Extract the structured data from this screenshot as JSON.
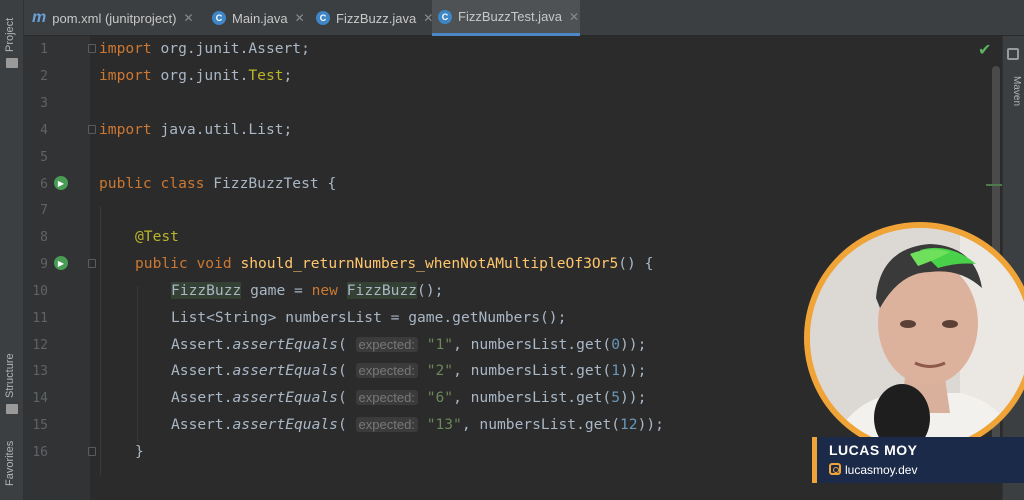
{
  "left_strip": {
    "project_label": "Project",
    "structure_label": "Structure",
    "favorites_label": "Favorites"
  },
  "tabs": [
    {
      "label": "pom.xml (junitproject)",
      "icon": "maven-m-icon",
      "active": false
    },
    {
      "label": "Main.java",
      "icon": "java-class-icon",
      "active": false
    },
    {
      "label": "FizzBuzz.java",
      "icon": "java-class-icon",
      "active": false
    },
    {
      "label": "FizzBuzzTest.java",
      "icon": "java-class-icon",
      "active": true
    }
  ],
  "tab_icon_letters": {
    "maven": "m",
    "class": "C"
  },
  "right_strip": {
    "maven_label": "Maven"
  },
  "editor": {
    "line_numbers": [
      "1",
      "2",
      "3",
      "4",
      "5",
      "6",
      "7",
      "8",
      "9",
      "10",
      "11",
      "12",
      "13",
      "14",
      "15",
      "16"
    ],
    "lines": {
      "l1": [
        "import",
        " org.junit.Assert;"
      ],
      "l2": [
        "import",
        " org.junit.",
        "Test",
        ";"
      ],
      "l4": [
        "import",
        " java.util.List;"
      ],
      "l6": [
        "public class",
        " FizzBuzzTest {"
      ],
      "l8": [
        "@Test"
      ],
      "l9": [
        "public void",
        " ",
        "should_returnNumbers_whenNotAMultipleOf3Or5",
        "() {"
      ],
      "l10": [
        "FizzBuzz",
        " game = ",
        "new",
        " ",
        "FizzBuzz",
        "();"
      ],
      "l11": [
        "List<String> numbersList = game.getNumbers();"
      ],
      "l12": [
        "Assert.",
        "assertEquals",
        "( ",
        "expected:",
        " ",
        "\"1\"",
        ", numbersList.get(",
        "0",
        "));"
      ],
      "l13": [
        "Assert.",
        "assertEquals",
        "( ",
        "expected:",
        " ",
        "\"2\"",
        ", numbersList.get(",
        "1",
        "));"
      ],
      "l14": [
        "Assert.",
        "assertEquals",
        "( ",
        "expected:",
        " ",
        "\"6\"",
        ", numbersList.get(",
        "5",
        "));"
      ],
      "l15": [
        "Assert.",
        "assertEquals",
        "( ",
        "expected:",
        " ",
        "\"13\"",
        ", numbersList.get(",
        "12",
        "));"
      ],
      "l16": [
        "}"
      ]
    }
  },
  "overlay": {
    "name": "LUCAS MOY",
    "handle": "lucasmoy.dev"
  },
  "colors": {
    "accent": "#f0a437",
    "keyword": "#cc7832",
    "string": "#6a8759",
    "number": "#6897bb",
    "annotation": "#bbb529",
    "method": "#ffc66d"
  }
}
